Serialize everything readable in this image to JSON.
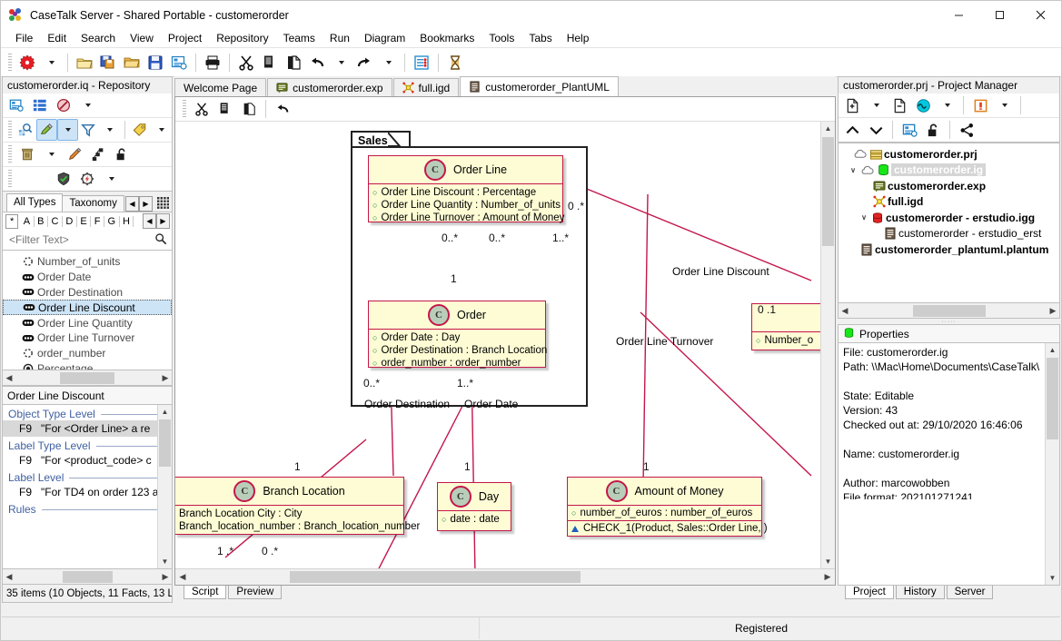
{
  "window": {
    "title": "CaseTalk Server - Shared Portable - customerorder",
    "minimize": "─",
    "maximize": "☐",
    "close": "✕"
  },
  "menu": [
    "File",
    "Edit",
    "Search",
    "View",
    "Project",
    "Repository",
    "Teams",
    "Run",
    "Diagram",
    "Bookmarks",
    "Tools",
    "Tabs",
    "Help"
  ],
  "toolbar": {
    "items": [
      {
        "name": "new-icon",
        "glyph": "✹"
      },
      {
        "name": "new-dropdown-icon",
        "glyph": ""
      },
      {
        "name": "open-project-icon",
        "glyph": ""
      },
      {
        "name": "save-all-icon",
        "glyph": ""
      },
      {
        "name": "open-folder-icon",
        "glyph": ""
      },
      {
        "name": "save-icon",
        "glyph": ""
      },
      {
        "name": "properties-icon",
        "glyph": ""
      },
      {
        "name": "print-icon",
        "glyph": ""
      },
      {
        "name": "cut-icon",
        "glyph": "✂"
      },
      {
        "name": "copy-icon",
        "glyph": ""
      },
      {
        "name": "paste-icon",
        "glyph": ""
      },
      {
        "name": "undo-icon",
        "glyph": "↶"
      },
      {
        "name": "redo-icon",
        "glyph": "↷"
      },
      {
        "name": "settings-icon",
        "glyph": ""
      },
      {
        "name": "hourglass-icon",
        "glyph": "⧗"
      }
    ]
  },
  "left_panel": {
    "title": "customerorder.iq - Repository",
    "type_tabs": [
      {
        "label": "All Types",
        "active": true
      },
      {
        "label": "Taxonomy",
        "active": false
      }
    ],
    "alpha_tabs": [
      "*",
      "A",
      "B",
      "C",
      "D",
      "E",
      "F",
      "G",
      "H"
    ],
    "filter": {
      "placeholder": "<Filter Text>",
      "value": ""
    },
    "items": [
      {
        "label": "Number_of_units",
        "icon": "dashed-circle-icon",
        "selected": false
      },
      {
        "label": "Order Date",
        "icon": "fact-icon",
        "selected": false
      },
      {
        "label": "Order Destination",
        "icon": "fact-icon",
        "selected": false
      },
      {
        "label": "Order Line Discount",
        "icon": "fact-icon",
        "selected": true
      },
      {
        "label": "Order Line Quantity",
        "icon": "fact-icon",
        "selected": false
      },
      {
        "label": "Order Line Turnover",
        "icon": "fact-icon",
        "selected": false
      },
      {
        "label": "order_number",
        "icon": "dashed-circle-icon",
        "selected": false
      },
      {
        "label": "Percentage",
        "icon": "solid-circle-icon",
        "selected": false
      }
    ],
    "detail_title": "Order Line Discount",
    "detail_groups": [
      {
        "heading": "Object Type Level",
        "rows": [
          {
            "key": "F9",
            "text": "\"For <Order Line> a re",
            "selected": true
          }
        ]
      },
      {
        "heading": "Label Type Level",
        "rows": [
          {
            "key": "F9",
            "text": "\"For <product_code> c",
            "selected": false
          }
        ]
      },
      {
        "heading": "Label Level",
        "rows": [
          {
            "key": "F9",
            "text": "\"For TD4 on order 123 a",
            "selected": false
          }
        ]
      },
      {
        "heading": "Rules",
        "rows": []
      }
    ],
    "status": "35 items (10 Objects, 11 Facts, 13 L"
  },
  "center": {
    "tabs": [
      {
        "label": "Welcome Page",
        "icon": "none",
        "active": false
      },
      {
        "label": "customerorder.exp",
        "icon": "exp-icon",
        "active": false
      },
      {
        "label": "full.igd",
        "icon": "igd-icon",
        "active": false
      },
      {
        "label": "customerorder_PlantUML",
        "icon": "doc-icon",
        "active": true
      }
    ],
    "editor_toolbar": [
      {
        "name": "cut-icon",
        "glyph": "✂"
      },
      {
        "name": "copy-icon",
        "glyph": ""
      },
      {
        "name": "paste-icon",
        "glyph": ""
      },
      {
        "name": "undo-icon",
        "glyph": "↶"
      }
    ],
    "bottom_tabs": [
      {
        "label": "Script",
        "active": true
      },
      {
        "label": "Preview",
        "active": false
      }
    ]
  },
  "diagram": {
    "package": "Sales",
    "classes": [
      {
        "name": "Order Line",
        "stereotype": "C",
        "attributes": [
          "Order Line Discount : Percentage",
          "Order Line Quantity : Number_of_units",
          "Order Line Turnover : Amount of Money"
        ],
        "constraints": []
      },
      {
        "name": "Order",
        "stereotype": "C",
        "attributes": [
          "Order Date : Day",
          "Order Destination : Branch Location",
          "order_number : order_number"
        ],
        "constraints": []
      },
      {
        "name": "Branch Location",
        "stereotype": "C",
        "attributes": [
          "Branch Location City : City",
          "Branch_location_number : Branch_location_number"
        ],
        "constraints": []
      },
      {
        "name": "Day",
        "stereotype": "C",
        "attributes": [
          "date : date"
        ],
        "constraints": []
      },
      {
        "name": "Amount of Money",
        "stereotype": "C",
        "attributes": [
          "number_of_euros : number_of_euros"
        ],
        "constraints": [
          "CHECK_1(Product, Sales::Order Line, )"
        ]
      },
      {
        "name": "",
        "stereotype": "",
        "attributes": [
          "Number_o"
        ],
        "constraints": []
      }
    ],
    "edge_labels": [
      "Order Line Discount",
      "Order Line Turnover",
      "Order Destination",
      "Order Date"
    ],
    "cardinalities": [
      "0 .*",
      "0..*",
      "0..*",
      "1..*",
      "1",
      "0..*",
      "1..*",
      "0 .1",
      "1",
      "1",
      "1",
      "1 .*",
      "0 .*"
    ]
  },
  "right_panel": {
    "title": "customerorder.prj - Project Manager",
    "tree": [
      {
        "label": "customerorder.prj",
        "indent": 0,
        "icon": "project-icon",
        "expander": "",
        "selected": false
      },
      {
        "label": "customerorder.ig",
        "indent": 1,
        "icon": "model-icon",
        "expander": "∨",
        "selected": true
      },
      {
        "label": "customerorder.exp",
        "indent": 2,
        "icon": "exp-icon",
        "expander": "",
        "selected": false
      },
      {
        "label": "full.igd",
        "indent": 2,
        "icon": "igd-icon",
        "expander": "",
        "selected": false
      },
      {
        "label": "customerorder - erstudio.igg",
        "indent": 2,
        "icon": "db-icon",
        "expander": "∨",
        "selected": false
      },
      {
        "label": "customerorder - erstudio_erst",
        "indent": 3,
        "icon": "doc-icon",
        "expander": "",
        "selected": false
      },
      {
        "label": "customerorder_plantuml.plantum",
        "indent": 1,
        "icon": "doc-icon",
        "expander": "",
        "selected": false
      }
    ],
    "properties_title": "Properties",
    "properties_lines": [
      "File: customerorder.ig",
      "Path: \\\\Mac\\Home\\Documents\\CaseTalk\\",
      "",
      "State: Editable",
      "Version: 43",
      "Checked out at: 29/10/2020 16:46:06",
      "",
      "Name: customerorder.ig",
      "",
      "Author: marcowobben",
      "File format: 202101271241"
    ],
    "tabs": [
      {
        "label": "Project",
        "active": true
      },
      {
        "label": "History",
        "active": false
      },
      {
        "label": "Server",
        "active": false
      }
    ]
  },
  "statusbar": {
    "left": "",
    "center": "Registered"
  },
  "colors": {
    "accent": "#c3174b",
    "class_fill": "#fdfcd4",
    "selection": "#cde4f7",
    "heading": "#3f5fa0"
  }
}
